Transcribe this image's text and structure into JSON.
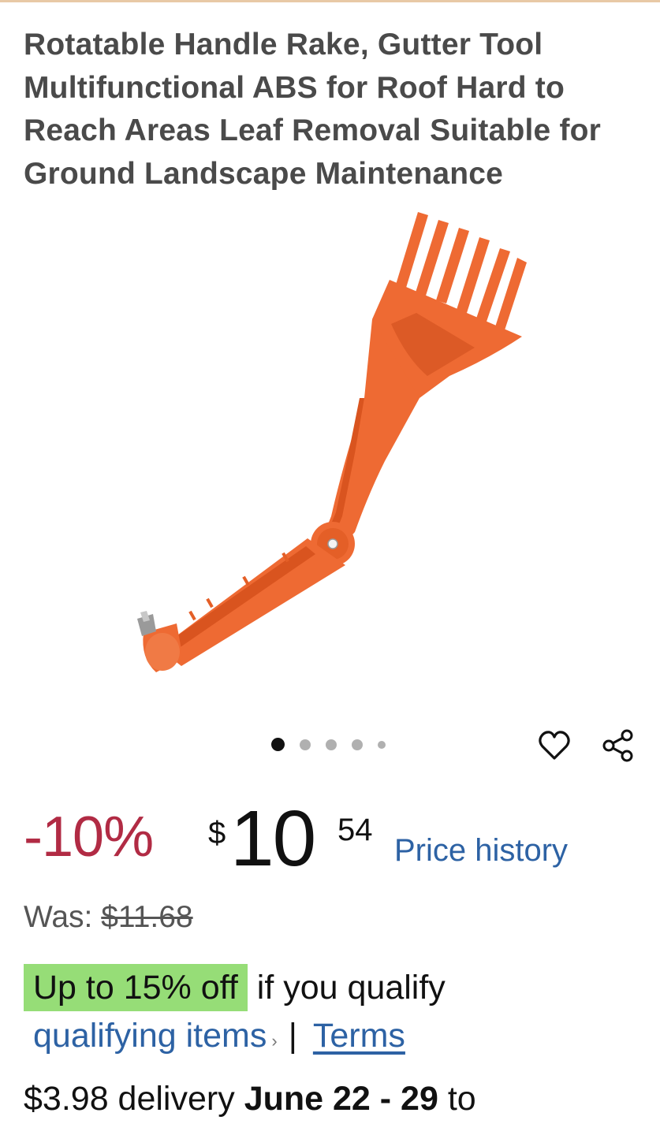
{
  "product": {
    "title": "Rotatable Handle Rake, Gutter Tool Multifunctional ABS for Roof Hard to Reach Areas Leaf Removal Suitable for Ground Landscape Maintenance",
    "image_icon": "orange-rake-gutter-tool-image"
  },
  "gallery": {
    "dot_count": 5,
    "active_index": 0
  },
  "actions": {
    "favorite_icon": "heart-icon",
    "share_icon": "share-icon"
  },
  "pricing": {
    "discount": "-10%",
    "currency": "$",
    "whole": "10",
    "fraction": "54",
    "price_history_label": "Price history",
    "was_label": "Was:",
    "was_price": "$11.68"
  },
  "promo": {
    "badge": "Up to 15% off",
    "text": "if you qualify",
    "qualifying_link": "qualifying items",
    "chevron": "›",
    "separator": "|",
    "terms_link": "Terms"
  },
  "delivery": {
    "cost": "$3.98 delivery",
    "dates": "June 22 - 29",
    "to": "to"
  },
  "colors": {
    "discount": "#b12b44",
    "link": "#2d62a4",
    "promo_badge": "#96dd77",
    "product_orange": "#ee6a33"
  }
}
